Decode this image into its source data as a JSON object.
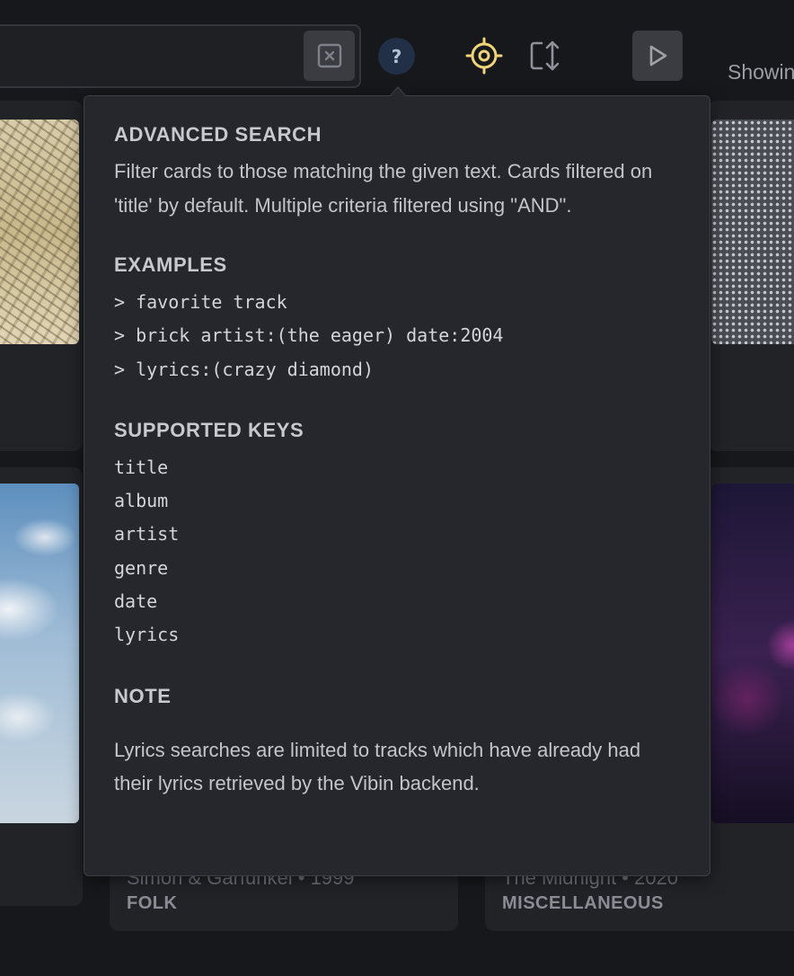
{
  "toolbar": {
    "clear_icon": "clear-x-icon",
    "help_label": "?",
    "locate_icon": "crosshair-icon",
    "resize_icon": "resize-vertical-icon",
    "play_icon": "play-icon",
    "showing_text": "Showin"
  },
  "cards": [
    {
      "meta": "Simon & Garfunkel • 1999",
      "genre": "FOLK"
    },
    {
      "meta": "The Midnight • 2020",
      "genre": "MISCELLANEOUS"
    }
  ],
  "help_popover": {
    "title": "ADVANCED SEARCH",
    "description": "Filter cards to those matching the given text. Cards filtered on 'title' by default. Multiple criteria filtered using \"AND\".",
    "examples_heading": "EXAMPLES",
    "examples": [
      "> favorite track",
      "> brick artist:(the eager) date:2004",
      "> lyrics:(crazy diamond)"
    ],
    "keys_heading": "SUPPORTED KEYS",
    "keys": [
      "title",
      "album",
      "artist",
      "genre",
      "date",
      "lyrics"
    ],
    "note_heading": "NOTE",
    "note_text": "Lyrics searches are limited to tracks which have already had their lyrics retrieved by the Vibin backend."
  },
  "colors": {
    "background": "#17181b",
    "popover_bg": "#26272c",
    "locate_accent": "#f0d47a",
    "help_button_bg": "#223047"
  }
}
